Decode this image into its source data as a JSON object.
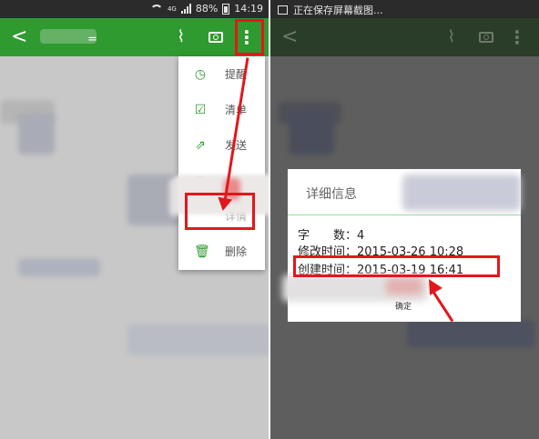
{
  "left_screen": {
    "status_bar": {
      "battery": "88%",
      "time": "14:19",
      "network": "4G"
    },
    "toolbar": {
      "back_icon": "back-arrow-icon",
      "attach_icon": "paperclip-icon",
      "camera_icon": "camera-icon",
      "more_icon": "more-vertical-icon",
      "more_glyph": "⋮",
      "back_glyph": "<",
      "title_partial": "="
    },
    "menu": {
      "items": [
        {
          "label": "提醒",
          "icon": "alarm-icon",
          "glyph": "◷"
        },
        {
          "label": "清单",
          "icon": "checklist-icon",
          "glyph": "☑"
        },
        {
          "label": "发送",
          "icon": "share-icon",
          "glyph": "⇗"
        },
        {
          "label": "",
          "icon": "circle-icon",
          "glyph": "○"
        },
        {
          "label": "详情",
          "icon": "info-icon",
          "glyph": ""
        },
        {
          "label": "删除",
          "icon": "trash-icon",
          "glyph": "🗑"
        }
      ]
    }
  },
  "right_screen": {
    "status_bar": {
      "notification": "正在保存屏幕截图..."
    },
    "dialog": {
      "title": "详细信息",
      "rows": [
        {
          "label": "字　　数：",
          "value": "4"
        },
        {
          "label": "修改时间：",
          "value": "2015-03-26 10:28"
        },
        {
          "label": "创建时间：",
          "value": "2015-03-19 16:41"
        }
      ],
      "signature": "确定"
    }
  },
  "colors": {
    "toolbar_green": "#2f9a2f",
    "annotation_red": "#e2171c",
    "overlay_gray": "#5e5e5e"
  }
}
